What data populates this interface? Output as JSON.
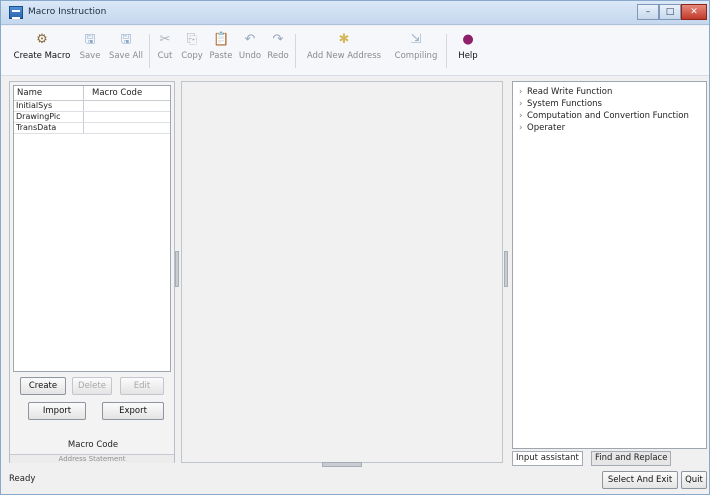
{
  "window": {
    "title": "Macro Instruction",
    "controls": {
      "minimize": "–",
      "maximize": "□",
      "close": "✕"
    }
  },
  "toolbar": {
    "items": [
      {
        "label": "Create Macro",
        "icon": "create-macro-icon",
        "glyph": "⚙",
        "enabled": true
      },
      {
        "label": "Save",
        "icon": "save-icon",
        "glyph": "🖫",
        "enabled": false
      },
      {
        "label": "Save All",
        "icon": "save-all-icon",
        "glyph": "🖫",
        "enabled": false
      },
      {
        "label": "Cut",
        "icon": "cut-icon",
        "glyph": "✂",
        "enabled": false
      },
      {
        "label": "Copy",
        "icon": "copy-icon",
        "glyph": "⎘",
        "enabled": false
      },
      {
        "label": "Paste",
        "icon": "paste-icon",
        "glyph": "📋",
        "enabled": false
      },
      {
        "label": "Undo",
        "icon": "undo-icon",
        "glyph": "↶",
        "enabled": false
      },
      {
        "label": "Redo",
        "icon": "redo-icon",
        "glyph": "↷",
        "enabled": false
      },
      {
        "label": "Add New Address",
        "icon": "add-address-icon",
        "glyph": "✱",
        "enabled": false
      },
      {
        "label": "Compiling",
        "icon": "compiling-icon",
        "glyph": "⇲",
        "enabled": false
      },
      {
        "label": "Help",
        "icon": "help-icon",
        "glyph": "●",
        "enabled": true
      }
    ]
  },
  "macro_list": {
    "columns": [
      "Name",
      "Macro Code"
    ],
    "rows": [
      {
        "name": "InitialSys",
        "code": ""
      },
      {
        "name": "DrawingPic",
        "code": ""
      },
      {
        "name": "TransData",
        "code": ""
      }
    ]
  },
  "left_buttons": {
    "create": "Create",
    "delete": "Delete",
    "edit": "Edit",
    "import": "Import",
    "export": "Export"
  },
  "left_captions": {
    "macro_code": "Macro Code",
    "address_statement": "Address Statement"
  },
  "assistant": {
    "tree": [
      "Read Write Function",
      "System Functions",
      "Computation and Convertion Function",
      "Operater"
    ]
  },
  "tabs": {
    "input_assistant": "Input assistant",
    "find_replace": "Find and Replace"
  },
  "bottom_buttons": {
    "select_exit": "Select And Exit",
    "quit": "Quit"
  },
  "status": {
    "text": "Ready"
  },
  "colors": {
    "title_bar": "#c4d7ee",
    "close_button": "#c0392b",
    "help_icon": "#8e1f6b"
  }
}
